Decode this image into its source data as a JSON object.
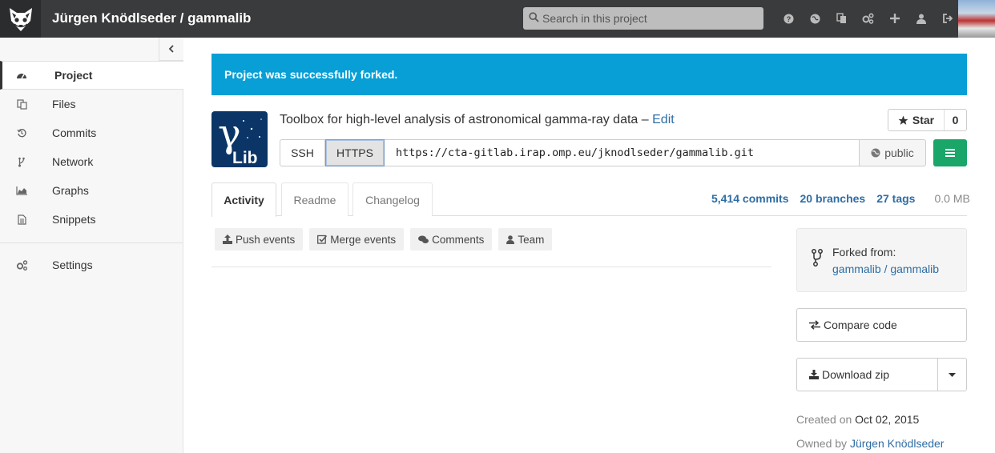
{
  "header": {
    "logo_icon": "gitlab-fox-logo-icon",
    "title": "Jürgen Knödlseder / gammalib",
    "search_placeholder": "Search in this project",
    "icons": [
      "help-icon",
      "explore-icon",
      "snippets-icon",
      "admin-gears-icon",
      "plus-icon",
      "profile-icon",
      "logout-icon"
    ]
  },
  "sidebar": {
    "items": [
      {
        "label": "Project",
        "icon": "dashboard-icon",
        "active": true
      },
      {
        "label": "Files",
        "icon": "files-icon"
      },
      {
        "label": "Commits",
        "icon": "history-icon"
      },
      {
        "label": "Network",
        "icon": "branch-icon"
      },
      {
        "label": "Graphs",
        "icon": "area-chart-icon"
      },
      {
        "label": "Snippets",
        "icon": "file-text-icon"
      }
    ],
    "settings_label": "Settings"
  },
  "flash": "Project was successfully forked.",
  "project": {
    "logo_text": "Lib",
    "logo_gamma": "γ",
    "description": "Toolbox for high-level analysis of astronomical gamma-ray data –",
    "edit_link": "Edit",
    "star_label": "Star",
    "star_count": "0",
    "clone": {
      "ssh": "SSH",
      "https": "HTTPS",
      "url": "https://cta-gitlab.irap.omp.eu/jknodlseder/gammalib.git",
      "visibility": "public"
    }
  },
  "tabs": [
    "Activity",
    "Readme",
    "Changelog"
  ],
  "stats": {
    "commits": "5,414 commits",
    "branches": "20 branches",
    "tags": "27 tags",
    "size": "0.0 MB"
  },
  "filters": [
    {
      "label": "Push events",
      "icon": "upload-icon"
    },
    {
      "label": "Merge events",
      "icon": "check-square-icon"
    },
    {
      "label": "Comments",
      "icon": "comments-icon"
    },
    {
      "label": "Team",
      "icon": "user-icon"
    }
  ],
  "fork": {
    "label": "Forked from:",
    "link": "gammalib / gammalib"
  },
  "compare_label": "Compare code",
  "download_label": "Download zip",
  "created": {
    "prefix": "Created on",
    "date": "Oct 02, 2015"
  },
  "owned": {
    "prefix": "Owned by",
    "owner": "Jürgen Knödlseder"
  },
  "colors": {
    "header": "#3a3b3d",
    "flash": "#079fd6",
    "accent_green": "#1aa569",
    "link": "#2e6da4"
  }
}
